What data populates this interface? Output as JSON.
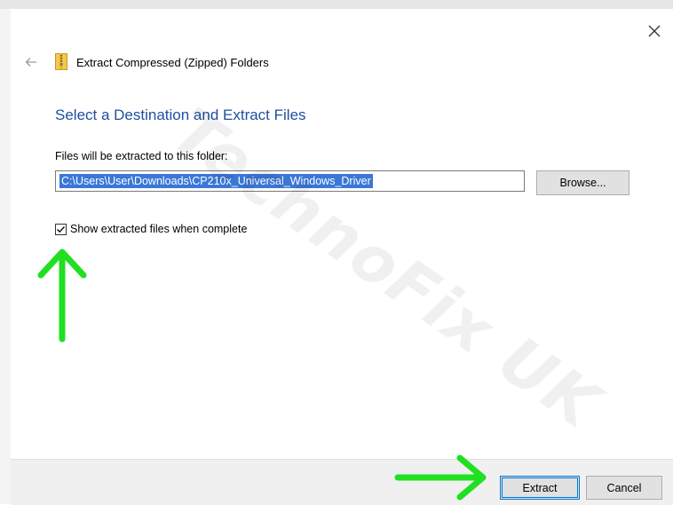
{
  "window": {
    "title": "Extract Compressed (Zipped) Folders",
    "close_glyph": "✕",
    "back_glyph": "←"
  },
  "main": {
    "heading": "Select a Destination and Extract Files",
    "destination_label": "Files will be extracted to this folder:",
    "destination_path": "C:\\Users\\User\\Downloads\\CP210x_Universal_Windows_Driver",
    "browse_label": "Browse...",
    "show_files_label": "Show extracted files when complete",
    "show_files_checked": true
  },
  "footer": {
    "extract_label": "Extract",
    "cancel_label": "Cancel"
  },
  "watermark": {
    "text": "TechnoFix UK"
  },
  "annotations": {
    "arrow_color": "#21e021",
    "arrows": [
      "up-arrow-to-checkbox",
      "right-arrow-to-extract"
    ]
  },
  "colors": {
    "heading": "#1f4fa0",
    "selection": "#3a77d7",
    "focus_border": "#0078d7"
  }
}
